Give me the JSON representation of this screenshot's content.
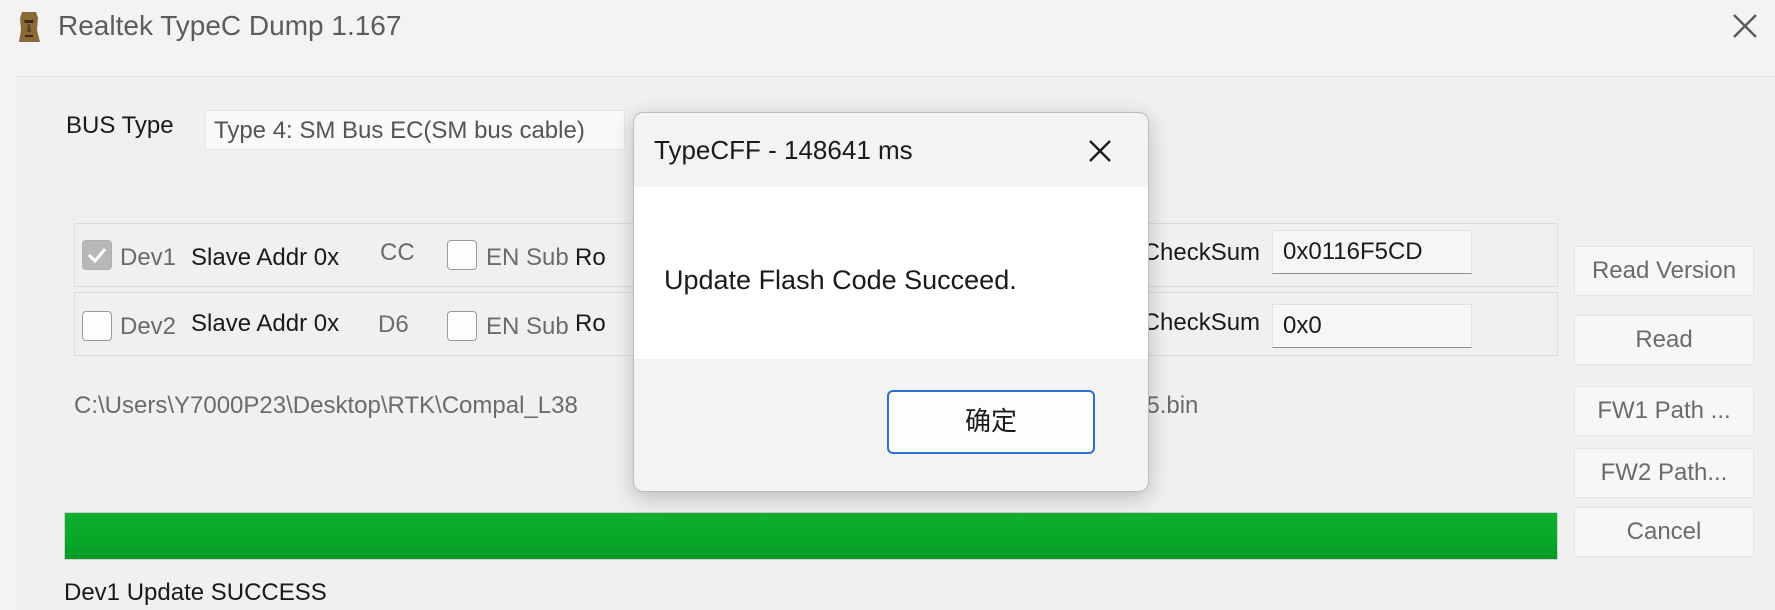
{
  "window": {
    "title": "Realtek TypeC Dump 1.167",
    "icon": "moai-head-icon",
    "close_icon": "close-icon"
  },
  "bus": {
    "label": "BUS Type",
    "value": "Type 4: SM Bus EC(SM bus cable)"
  },
  "dev1": {
    "checkbox_label": "Dev1",
    "checked": true,
    "slave_label": "Slave Addr 0x",
    "slave_value": "CC",
    "en_sub_label": "EN Sub",
    "ro_label": "Ro",
    "checksum_label": "W1 CheckSum",
    "checksum_value": "0x0116F5CD"
  },
  "dev2": {
    "checkbox_label": "Dev2",
    "checked": false,
    "slave_label": "Slave Addr 0x",
    "slave_value": "D6",
    "en_sub_label": "EN Sub",
    "ro_label": "Ro",
    "checksum_label": "W2 CheckSum",
    "checksum_value": "0x0"
  },
  "buttons": {
    "read_version": "Read Version",
    "read": "Read",
    "fw1_path": "FW1 Path ...",
    "fw2_path": "FW2 Path...",
    "cancel": "Cancel"
  },
  "fw_path": {
    "left": "C:\\Users\\Y7000P23\\Desktop\\RTK\\Compal_L38",
    "right": "25.bin"
  },
  "progress": {
    "percent": 100,
    "color": "#06a828"
  },
  "status": "Dev1 Update SUCCESS",
  "dialog": {
    "title": "TypeCFF - 148641 ms",
    "message": "Update Flash Code Succeed.",
    "ok_label": "确定",
    "accent": "#2d6fd1"
  }
}
